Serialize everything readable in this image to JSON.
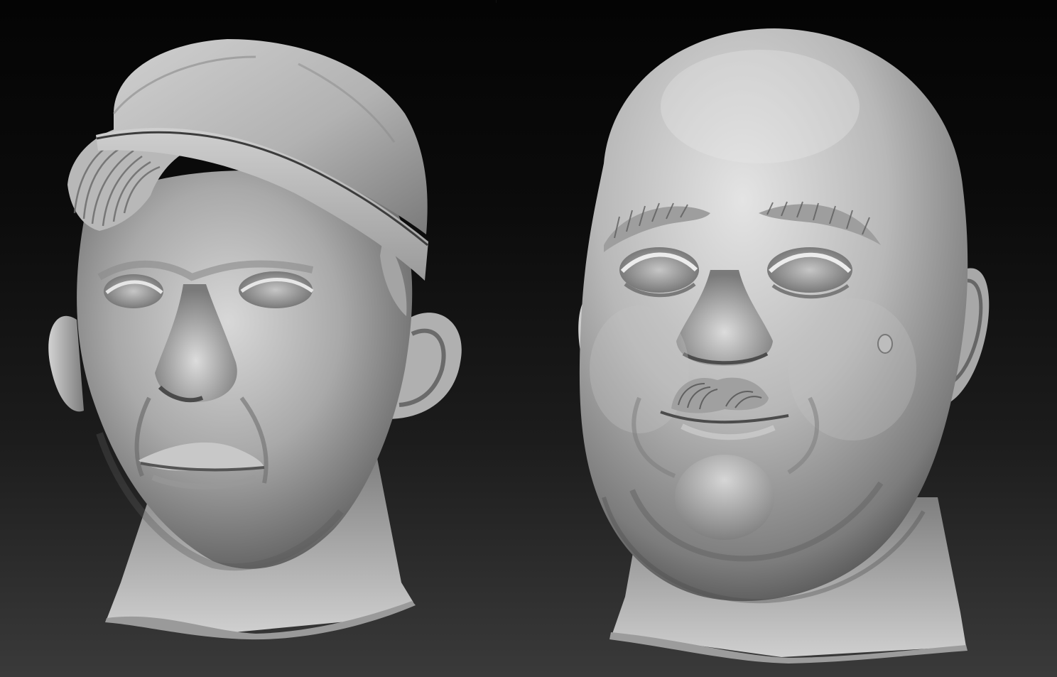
{
  "scene": {
    "background_top": "#040404",
    "background_bottom": "#3a3a3a",
    "material_highlight": "#e8e8e8",
    "material_mid": "#8f8f8f",
    "material_shadow": "#2a2a2a"
  },
  "models": [
    {
      "name": "young-man-head-with-garrison-cap",
      "features": [
        "garrison-cap",
        "wavy-hair-fringe",
        "closed-eyes",
        "ears",
        "neck"
      ]
    },
    {
      "name": "bald-heavy-man-head-with-mustache",
      "features": [
        "bald-cranium",
        "bushy-eyebrows",
        "closed-eyes",
        "mustache",
        "mole",
        "double-chin",
        "ears",
        "neck"
      ]
    }
  ]
}
